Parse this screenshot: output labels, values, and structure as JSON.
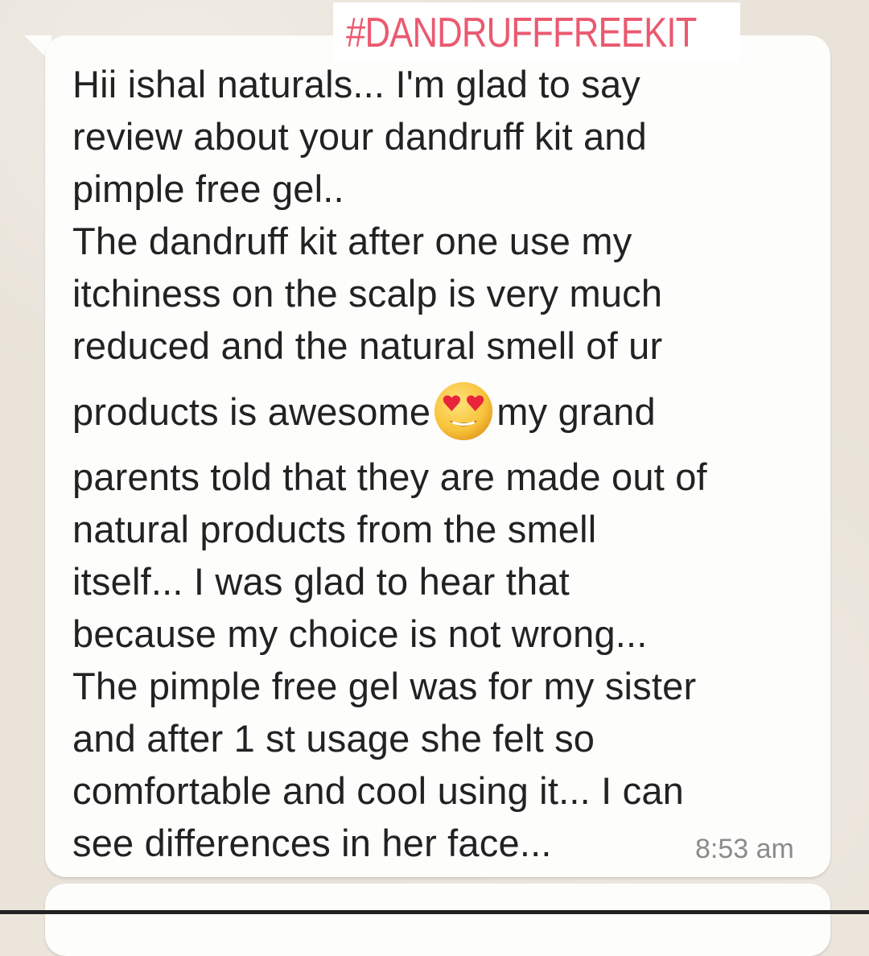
{
  "overlay": {
    "hashtag": "#DANDRUFFFREEKIT"
  },
  "message": {
    "lines": [
      "Hii ishal naturals... I'm glad to say",
      "review about your dandruff kit and",
      "pimple free gel..",
      "The dandruff kit after one use my",
      "itchiness on the scalp is very much",
      "reduced and the natural smell of ur"
    ],
    "line_emoji_before": "products is awesome",
    "emoji_name": "heart-eyes-emoji",
    "line_emoji_after": "my grand",
    "lines_after": [
      "parents told that they are made out of",
      "natural products from the smell",
      "itself... I was glad to hear that",
      "because my choice is not wrong...",
      "The pimple free gel was for my sister",
      "and after 1 st usage she felt so",
      "comfortable and cool using it... I can",
      "see differences in her face..."
    ],
    "time": "8:53 am"
  },
  "colors": {
    "hashtag": "#ea5a70",
    "bubble": "#fdfdfc",
    "wallpaper": "#e9e3d9",
    "text": "#222222",
    "time": "#8b8b8b"
  }
}
